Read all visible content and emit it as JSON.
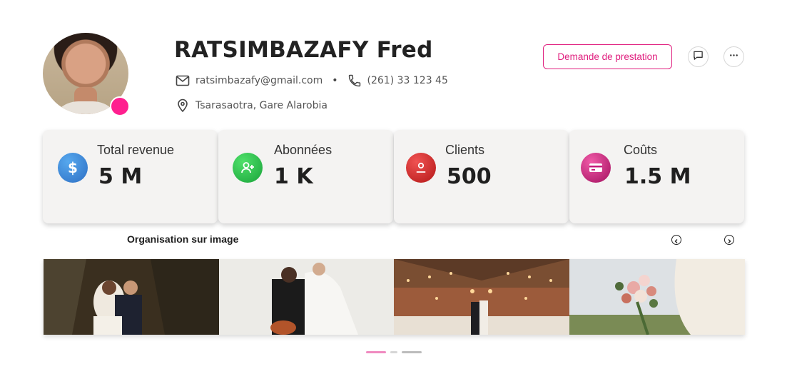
{
  "profile": {
    "name": "RATSIMBAZAFY Fred",
    "email": "ratsimbazafy@gmail.com",
    "phone": "(261) 33 123 45",
    "address": "Tsarasaotra, Gare Alarobia",
    "status_color": "#ff1f8f"
  },
  "actions": {
    "request_label": "Demande de prestation",
    "message_icon": "chat-icon",
    "more_icon": "more-icon"
  },
  "stats": [
    {
      "label": "Total revenue",
      "value": "5 M",
      "icon": "dollar-icon",
      "color": "#3b82d6"
    },
    {
      "label": "Abonnées",
      "value": "1 K",
      "icon": "add-user-icon",
      "color": "#2bb24a"
    },
    {
      "label": "Clients",
      "value": "500",
      "icon": "user-icon",
      "color": "#d62a2a"
    },
    {
      "label": "Coûts",
      "value": "1.5 M",
      "icon": "credit-card-icon",
      "color": "#c2187a"
    }
  ],
  "gallery": {
    "title": "Organisation sur image",
    "prev_icon": "chevron-left-icon",
    "next_icon": "chevron-right-icon",
    "pagination_color": "#f08ac0"
  }
}
